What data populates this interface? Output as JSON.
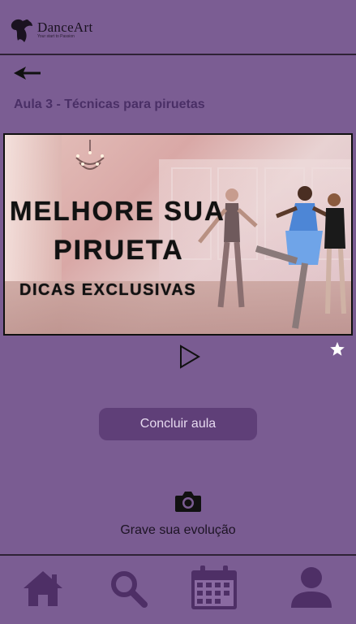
{
  "header": {
    "brand_name": "DanceArt",
    "brand_tagline": "Your start to Passion"
  },
  "lesson": {
    "title": "Aula 3 - Técnicas para piruetas"
  },
  "video": {
    "promo_line1": "MELHORE SUA",
    "promo_line2": "PIRUETA",
    "promo_line3": "DICAS EXCLUSIVAS"
  },
  "actions": {
    "finish_label": "Concluir aula",
    "record_label": "Grave sua evolução"
  },
  "bottom_nav": {
    "items": [
      "home-icon",
      "search-icon",
      "calendar-icon",
      "profile-icon"
    ]
  },
  "colors": {
    "background": "#7a5c92",
    "title": "#4a2f66",
    "button": "#5f3f78",
    "icon": "#4e2f66"
  }
}
